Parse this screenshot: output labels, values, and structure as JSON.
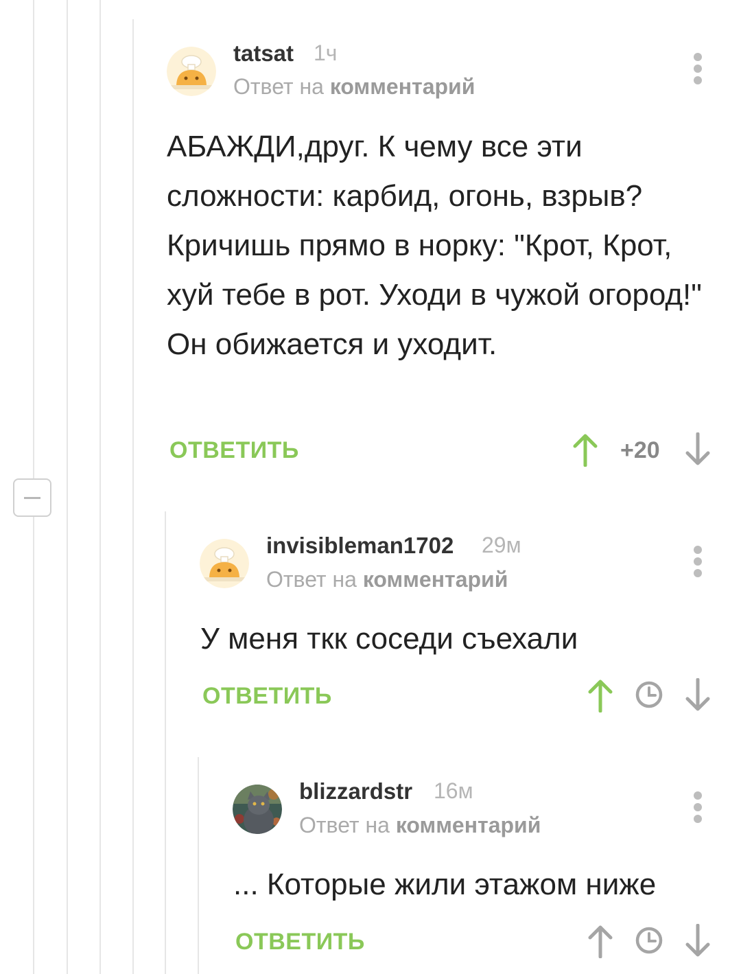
{
  "comments": [
    {
      "username": "tatsat",
      "time": "1ч",
      "reply_prefix": "Ответ на",
      "reply_target": "комментарий",
      "text": "АБАЖДИ,друг. К чему все эти сложности: карбид, огонь, взрыв? Кричишь прямо в норку: \"Крот, Крот, хуй тебе в рот. Уходи в чужой огород!\" Он обижается и уходит.",
      "reply_label": "ОТВЕТИТЬ",
      "rating": "+20",
      "upvoted": true
    },
    {
      "username": "invisibleman1702",
      "time": "29м",
      "reply_prefix": "Ответ на",
      "reply_target": "комментарий",
      "text": "У меня ткк соседи съехали",
      "reply_label": "ОТВЕТИТЬ",
      "rating_icon": "clock-icon",
      "upvoted": true
    },
    {
      "username": "blizzardstr",
      "time": "16м",
      "reply_prefix": "Ответ на",
      "reply_target": "комментарий",
      "text": "... Которые жили этажом ниже",
      "reply_label": "ОТВЕТИТЬ",
      "rating_icon": "clock-icon",
      "upvoted": false
    }
  ],
  "colors": {
    "accent_green": "#8ac858",
    "vote_gray": "#9e9e9e",
    "thread_line": "#e6e6e6"
  }
}
